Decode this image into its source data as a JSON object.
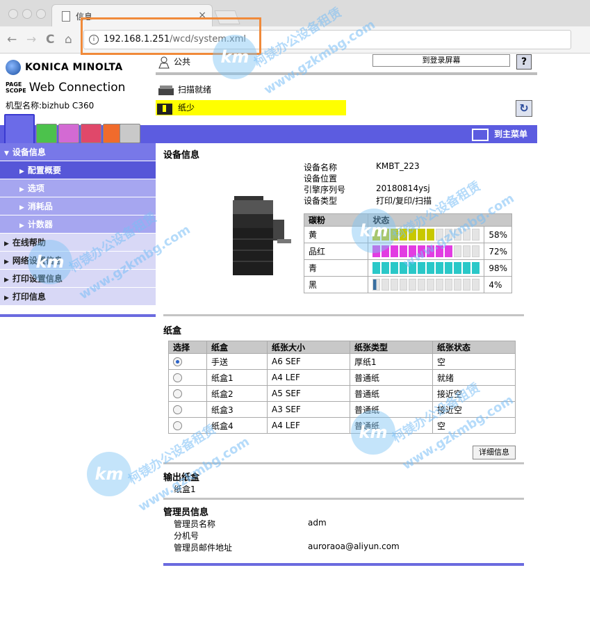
{
  "browser": {
    "tab_title": "信息",
    "tab_close": "×",
    "url_host": "192.168.1.251",
    "url_path": "/wcd/system.xml",
    "info_glyph": "i",
    "back_glyph": "←",
    "forward_glyph": "→",
    "reload_glyph": "C",
    "home_glyph": "⌂"
  },
  "header": {
    "brand": "KONICA MINOLTA",
    "page_scope": "PAGE\nSCOPE",
    "web_connection": "Web Connection",
    "model_label": "机型名称:bizhub C360",
    "public_label": "公共",
    "login_button": "到登录屏幕",
    "help_button": "?",
    "scan_status": "扫描就绪",
    "paper_status": "纸少",
    "refresh_glyph": "↻",
    "main_menu": "到主菜单"
  },
  "sidebar": {
    "items": [
      {
        "label": "设备信息",
        "arrow": "▼",
        "kind": "head"
      },
      {
        "label": "配置概要",
        "arrow": "▶",
        "kind": "sub sel"
      },
      {
        "label": "选项",
        "arrow": "▶",
        "kind": "sub"
      },
      {
        "label": "消耗品",
        "arrow": "▶",
        "kind": "sub"
      },
      {
        "label": "计数器",
        "arrow": "▶",
        "kind": "sub"
      },
      {
        "label": "在线帮助",
        "arrow": "▶",
        "kind": ""
      },
      {
        "label": "网络设置信息",
        "arrow": "▶",
        "kind": ""
      },
      {
        "label": "打印设置信息",
        "arrow": "▶",
        "kind": ""
      },
      {
        "label": "打印信息",
        "arrow": "▶",
        "kind": ""
      }
    ]
  },
  "device_info": {
    "title": "设备信息",
    "fields": [
      {
        "label": "设备名称",
        "value": "KMBT_223"
      },
      {
        "label": "设备位置",
        "value": ""
      },
      {
        "label": "引擎序列号",
        "value": "20180814ysj"
      },
      {
        "label": "设备类型",
        "value": "打印/复印/扫描"
      }
    ],
    "toner_headers": [
      "碳粉",
      "状态"
    ],
    "toners": [
      {
        "name": "黄",
        "percent": "58%",
        "level": 0.58,
        "color": "#c8c800"
      },
      {
        "name": "品红",
        "percent": "72%",
        "level": 0.72,
        "color": "#e23ce2"
      },
      {
        "name": "青",
        "percent": "98%",
        "level": 0.98,
        "color": "#2ac8c8"
      },
      {
        "name": "黑",
        "percent": "4%",
        "level": 0.04,
        "color": "#333333"
      }
    ]
  },
  "trays": {
    "title": "纸盒",
    "headers": [
      "选择",
      "纸盒",
      "纸张大小",
      "纸张类型",
      "纸张状态"
    ],
    "rows": [
      {
        "selected": true,
        "tray": "手送",
        "size": "A6 SEF",
        "type": "厚纸1",
        "status": "空"
      },
      {
        "selected": false,
        "tray": "纸盒1",
        "size": "A4 LEF",
        "type": "普通纸",
        "status": "就绪"
      },
      {
        "selected": false,
        "tray": "纸盒2",
        "size": "A5 SEF",
        "type": "普通纸",
        "status": "接近空"
      },
      {
        "selected": false,
        "tray": "纸盒3",
        "size": "A3 SEF",
        "type": "普通纸",
        "status": "接近空"
      },
      {
        "selected": false,
        "tray": "纸盒4",
        "size": "A4 LEF",
        "type": "普通纸",
        "status": "空"
      }
    ],
    "detail_button": "详细信息"
  },
  "output_tray": {
    "title": "输出纸盒",
    "value": "纸盒1"
  },
  "admin": {
    "title": "管理员信息",
    "fields": [
      {
        "label": "管理员名称",
        "value": "adm"
      },
      {
        "label": "分机号",
        "value": ""
      },
      {
        "label": "管理员邮件地址",
        "value": "auroraoa@aliyun.com"
      }
    ]
  },
  "watermark": {
    "text1": "柯镁办公设备租赁",
    "text2": "www.gzkmbg.com",
    "logo": "km"
  }
}
